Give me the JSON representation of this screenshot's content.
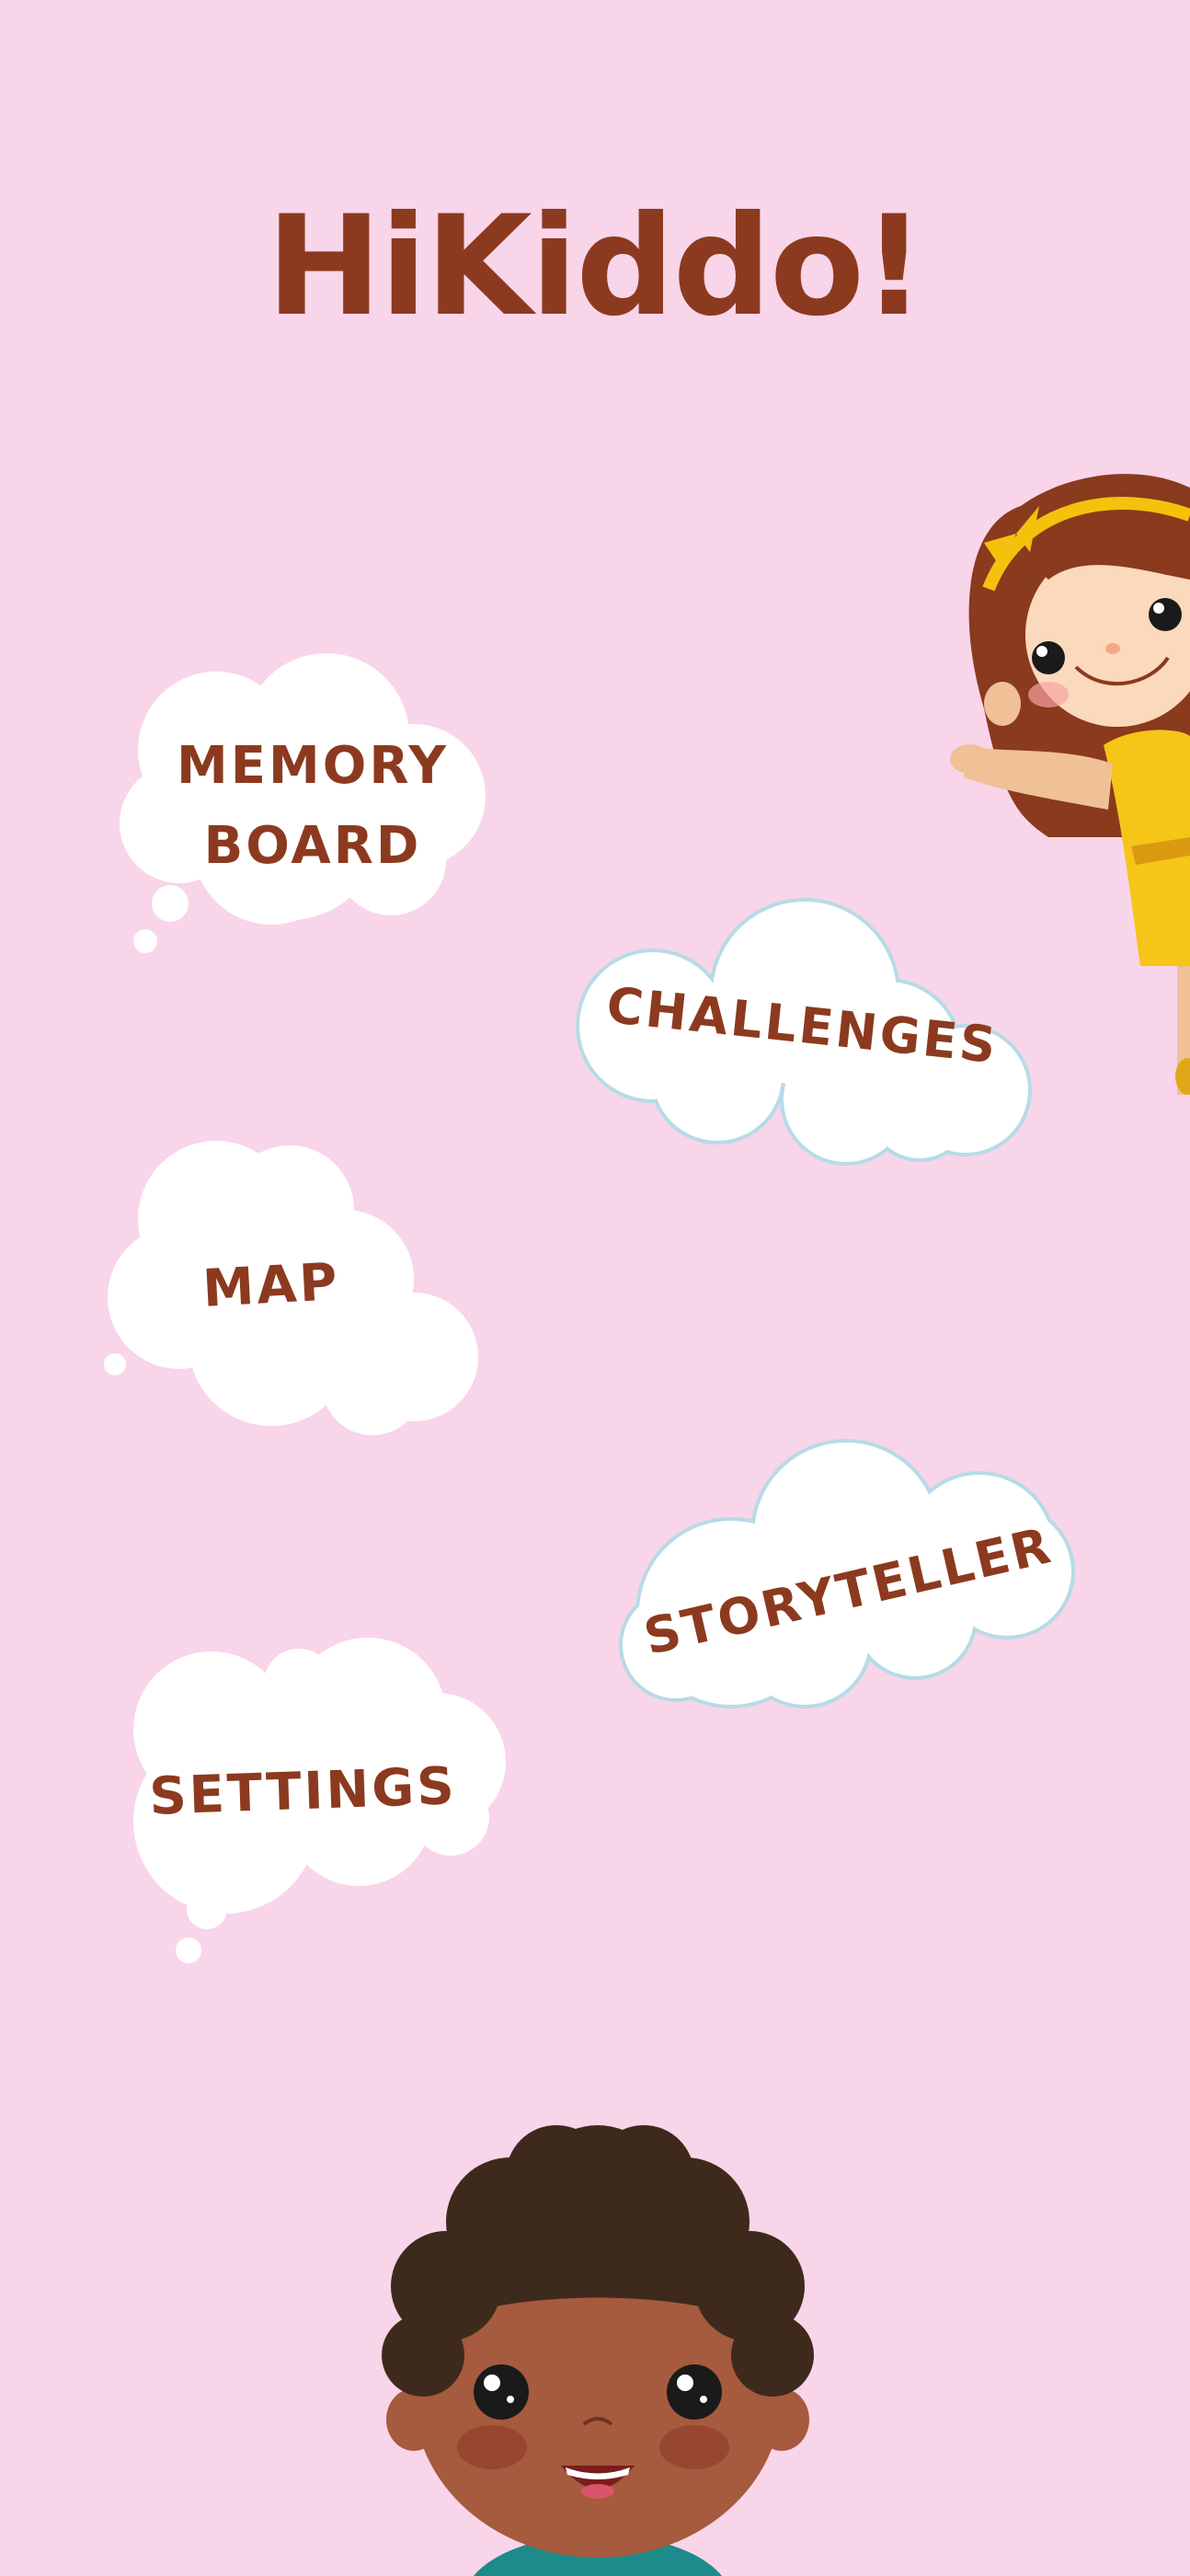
{
  "app": {
    "title": "HiKiddo!"
  },
  "menu": {
    "memory_board": "MEMORY\nBOARD",
    "challenges": "CHALLENGES",
    "map": "MAP",
    "storyteller": "STORYTELLER",
    "settings": "SETTINGS"
  },
  "colors": {
    "background": "#f8d5e9",
    "text": "#8c3a1f",
    "cloud": "#ffffff",
    "cloud_outline": "#b6dbe6"
  },
  "illustrations": [
    "girl-character",
    "boy-character"
  ]
}
